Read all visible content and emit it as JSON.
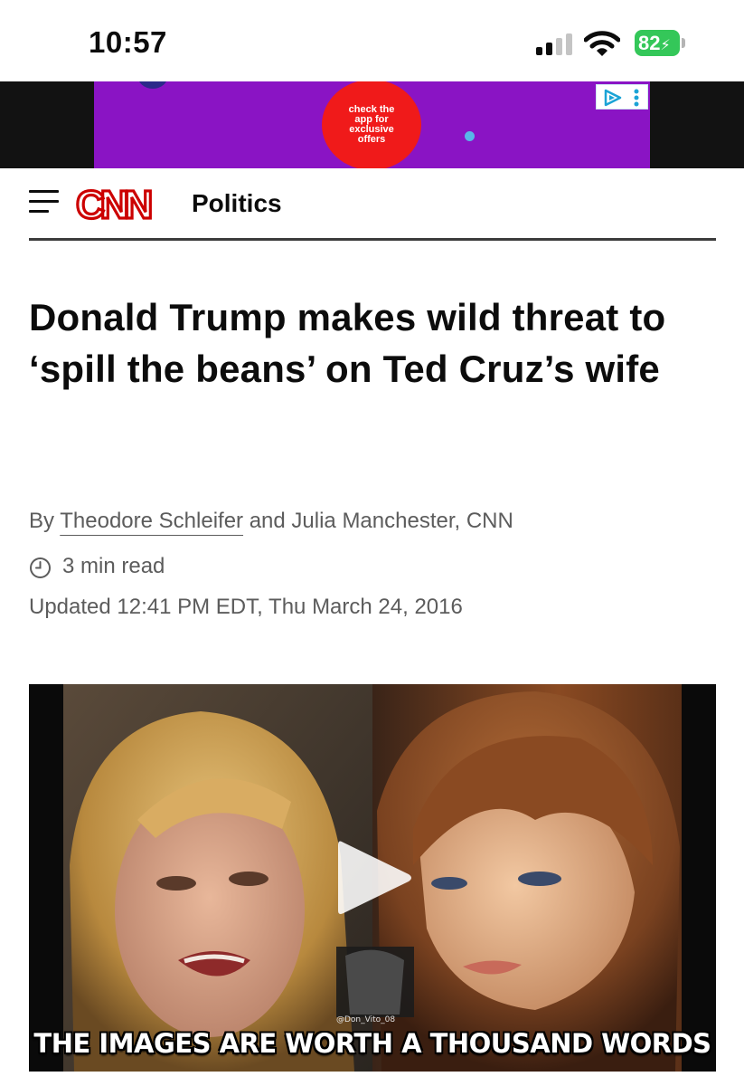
{
  "status_bar": {
    "time": "10:57",
    "battery": "82",
    "battery_color": "#34c759"
  },
  "ad": {
    "offer_text": "check the app for exclusive offers",
    "background_color": "#8a14c4",
    "badge_color": "#f01a1a"
  },
  "header": {
    "menu_icon": "hamburger-menu-icon",
    "logo_text": "CNN",
    "logo_color": "#cc0000",
    "section": "Politics"
  },
  "article": {
    "headline": "Donald Trump makes wild threat to ‘spill the beans’ on Ted Cruz’s wife",
    "byline_prefix": "By ",
    "author_1": "Theodore Schleifer",
    "byline_rest": " and Julia Manchester, CNN",
    "read_time": "3 min read",
    "updated": "Updated 12:41 PM EDT, Thu March 24, 2016"
  },
  "video": {
    "play_icon": "play-icon",
    "watermark": "@Don_Vito_08",
    "caption": "THE IMAGES ARE WORTH A THOUSAND WORDS"
  }
}
